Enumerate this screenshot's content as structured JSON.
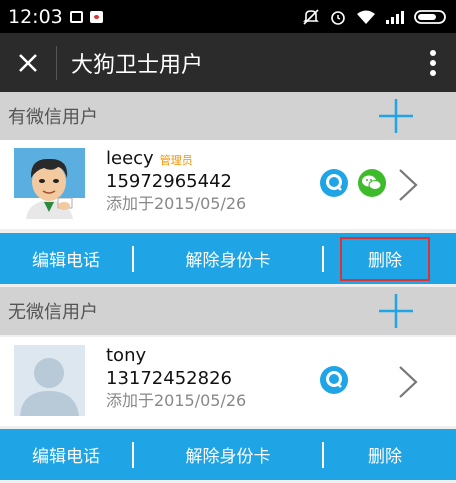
{
  "status_bar": {
    "time": "12:03"
  },
  "header": {
    "title": "大狗卫士用户"
  },
  "sections": {
    "with_wechat": {
      "title": "有微信用户",
      "user": {
        "name": "leecy",
        "badge": "管理员",
        "phone": "15972965442",
        "added": "添加于2015/05/26"
      },
      "actions": {
        "edit_phone": "编辑电话",
        "remove_id_card": "解除身份卡",
        "delete": "删除"
      }
    },
    "without_wechat": {
      "title": "无微信用户",
      "user": {
        "name": "tony",
        "phone": "13172452826",
        "added": "添加于2015/05/26"
      },
      "actions": {
        "edit_phone": "编辑电话",
        "remove_id_card": "解除身份卡",
        "delete": "删除"
      }
    }
  },
  "colors": {
    "accent_blue": "#1fa5e6",
    "header_dark": "#2b2b2b",
    "badge_orange": "#f29200",
    "highlight_red": "#e03030",
    "wechat_green": "#3dbb2b"
  },
  "icons": [
    "close-icon",
    "more-vert-icon",
    "add-icon",
    "qq-icon",
    "wechat-icon",
    "chevron-right-icon"
  ]
}
